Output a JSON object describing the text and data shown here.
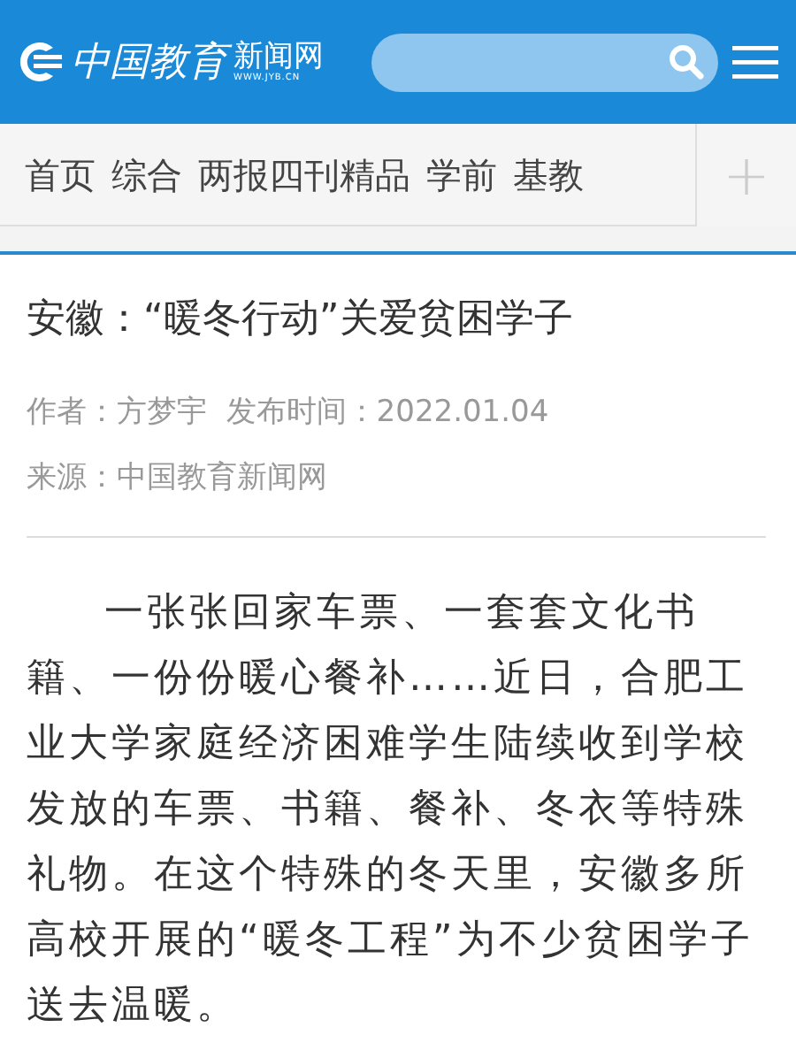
{
  "header": {
    "logo": {
      "calligraphy": "中国教育",
      "name": "新闻网",
      "domain": "WWW.JYB.CN"
    }
  },
  "nav": {
    "items": [
      {
        "label": "首页"
      },
      {
        "label": "综合"
      },
      {
        "label": "两报四刊精品"
      },
      {
        "label": "学前"
      },
      {
        "label": "基教"
      }
    ],
    "more": "+"
  },
  "article": {
    "title": "安徽：“暖冬行动”关爱贫困学子",
    "meta": [
      "作者：方梦宇  发布时间：2022.01.04",
      "来源：中国教育新闻网"
    ],
    "body": "一张张回家车票、一套套文化书籍、一份份暖心餐补……近日，合肥工业大学家庭经济困难学生陆续收到学校发放的车票、书籍、餐补、冬衣等特殊礼物。在这个特殊的冬天里，安徽多所高校开展的“暖冬工程”为不少贫困学子送去温暖。"
  }
}
